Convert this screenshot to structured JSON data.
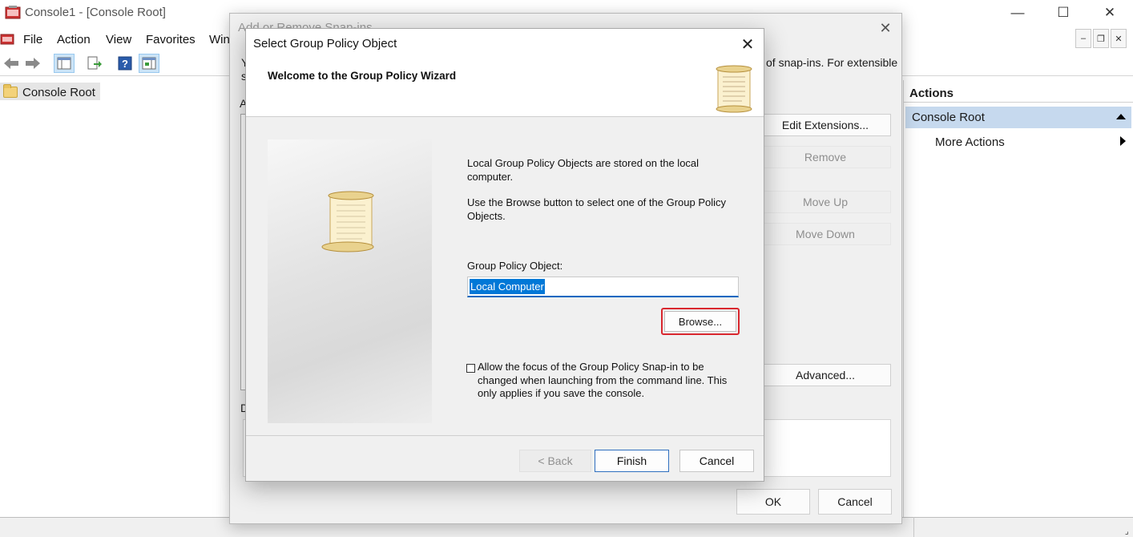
{
  "window": {
    "title": "Console1 - [Console Root]",
    "minimize_glyph": "—",
    "maximize_glyph": "☐",
    "close_glyph": "✕"
  },
  "menu": {
    "items": [
      "File",
      "Action",
      "View",
      "Favorites",
      "Win"
    ]
  },
  "mdi": {
    "min": "–",
    "restore": "❐",
    "close": "✕"
  },
  "toolbar": {
    "icons": [
      "back-arrow-icon",
      "forward-arrow-icon",
      "show-tree-icon",
      "export-list-icon",
      "help-icon",
      "action-pane-icon"
    ],
    "help_glyph": "?"
  },
  "tree": {
    "root_label": "Console Root"
  },
  "actions_pane": {
    "header": "Actions",
    "section": "Console Root",
    "more_actions": "More Actions"
  },
  "snapin_dialog": {
    "title": "Add or Remove Snap-ins",
    "close_glyph": "✕",
    "description_partial": "of snap-ins. For extensible",
    "left_peek": [
      "Y",
      "s",
      "A",
      "D"
    ],
    "buttons": {
      "edit_extensions": "Edit Extensions...",
      "remove": "Remove",
      "move_up": "Move Up",
      "move_down": "Move Down",
      "advanced": "Advanced...",
      "ok": "OK",
      "cancel": "Cancel"
    }
  },
  "gpo_dialog": {
    "title": "Select Group Policy Object",
    "close_glyph": "✕",
    "heading": "Welcome to the Group Policy Wizard",
    "info1": "Local Group Policy Objects are stored on the local computer.",
    "info2": "Use the Browse button to select one of the Group Policy Objects.",
    "field_label": "Group Policy Object:",
    "field_value": "Local Computer",
    "browse_label": "Browse...",
    "checkbox_label": "Allow the focus of the Group Policy Snap-in to be changed when launching from the command line.  This only applies if you save the console.",
    "checkbox_checked": false,
    "back_label": "< Back",
    "finish_label": "Finish",
    "cancel_label": "Cancel"
  },
  "colors": {
    "highlight": "#d9272e",
    "selection": "#0078d7",
    "actions_section": "#c6d9ee"
  }
}
